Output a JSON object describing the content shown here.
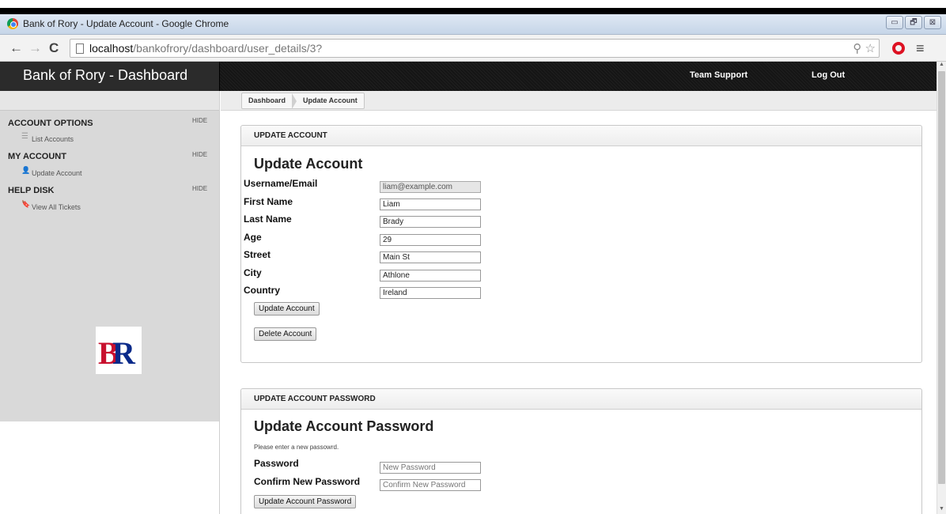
{
  "browser": {
    "window_title": "Bank of Rory - Update Account - Google Chrome",
    "url_host": "localhost",
    "url_path": "/bankofrory/dashboard/user_details/3?",
    "back_icon": "←",
    "forward_icon": "→",
    "reload_icon": "C",
    "menu_icon": "≡",
    "minimize_icon": "▭",
    "restore_icon": "🗗",
    "close_icon": "⊠"
  },
  "header": {
    "brand": "Bank of Rory - Dashboard",
    "links": [
      "Team Support",
      "Log Out"
    ]
  },
  "sidebar": {
    "sections": [
      {
        "title": "ACCOUNT OPTIONS",
        "hide": "HIDE",
        "items": [
          {
            "label": "List Accounts",
            "icon": "list-icon",
            "glyph": "☰"
          }
        ]
      },
      {
        "title": "MY ACCOUNT",
        "hide": "HIDE",
        "items": [
          {
            "label": "Update Account",
            "icon": "user-icon",
            "glyph": "👤"
          }
        ]
      },
      {
        "title": "HELP DISK",
        "hide": "HIDE",
        "items": [
          {
            "label": "View All Tickets",
            "icon": "bookmark-icon",
            "glyph": "🔖"
          }
        ]
      }
    ],
    "logo_text": "BR"
  },
  "breadcrumb": [
    "Dashboard",
    "Update Account"
  ],
  "update_account": {
    "panel_title": "UPDATE ACCOUNT",
    "heading": "Update Account",
    "fields": [
      {
        "label": "Username/Email",
        "value": "liam@example.com"
      },
      {
        "label": "First Name",
        "value": "Liam"
      },
      {
        "label": "Last Name",
        "value": "Brady"
      },
      {
        "label": "Age",
        "value": "29"
      },
      {
        "label": "Street",
        "value": "Main St"
      },
      {
        "label": "City",
        "value": "Athlone"
      },
      {
        "label": "Country",
        "value": "Ireland"
      }
    ],
    "update_button": "Update Account",
    "delete_button": "Delete Account"
  },
  "update_password": {
    "panel_title": "UPDATE ACCOUNT PASSWORD",
    "heading": "Update Account Password",
    "hint": "Please enter a new passowrd.",
    "password_label": "Password",
    "password_placeholder": "New Password",
    "confirm_label": "Confirm New Password",
    "confirm_placeholder": "Confirm New Password",
    "submit_button": "Update Account Password"
  }
}
